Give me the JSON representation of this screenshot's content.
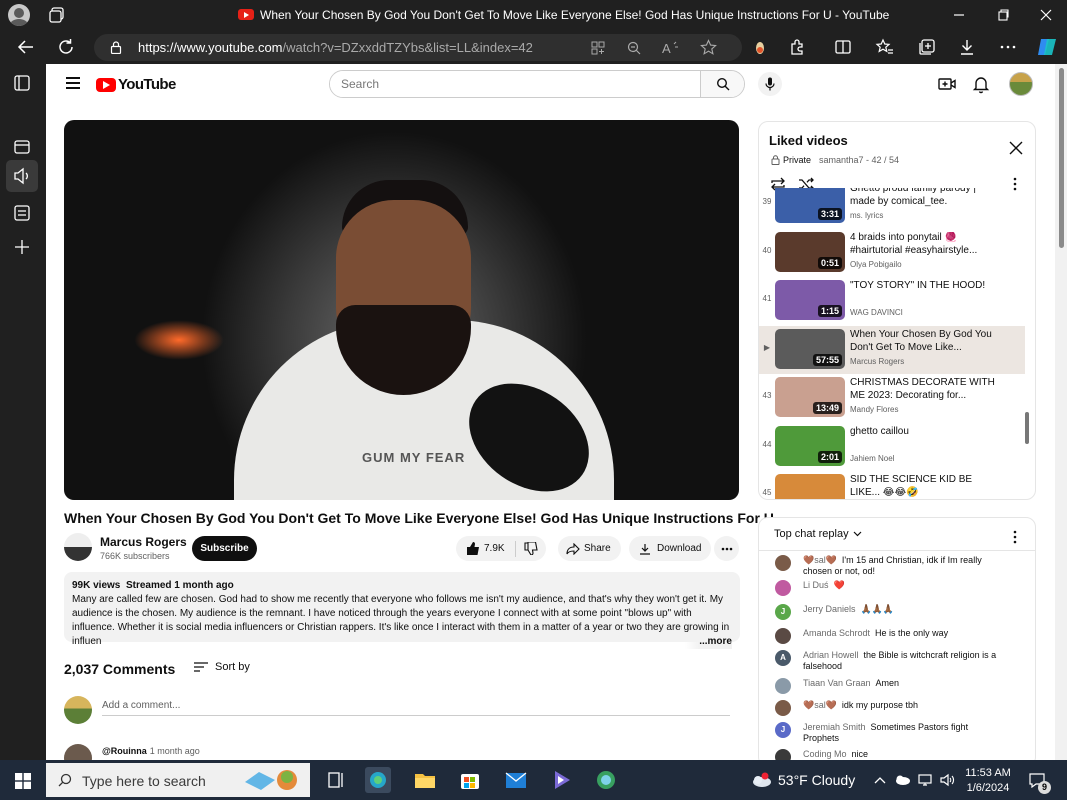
{
  "window": {
    "title": "When Your Chosen By God You Don't Get To Move Like Everyone Else! God Has Unique Instructions For U - YouTube"
  },
  "address": {
    "url_domain": "https://www.youtube.com",
    "url_path": "/watch?v=DZxxddTZYbs&list=LL&index=42"
  },
  "youtube_header": {
    "logo_text": "YouTube",
    "search_placeholder": "Search"
  },
  "video": {
    "shirt_text": "GUM MY FEAR",
    "title": "When Your Chosen By God You Don't Get To Move Like Everyone Else! God Has Unique Instructions For U",
    "channel": "Marcus Rogers",
    "subscribers": "766K subscribers",
    "subscribe_label": "Subscribe",
    "likes": "7.9K",
    "share_label": "Share",
    "download_label": "Download"
  },
  "description": {
    "views": "99K views",
    "streamed": "Streamed 1 month ago",
    "text": "Many are called few are chosen. God had to show me recently that everyone who follows me isn't my audience, and that's why they won't get it. My audience is the chosen. My audience is the remnant. I have noticed through the years everyone I connect with at some point \"blows up\" with influence. Whether it is social media influencers or Christian rappers. It's like once I interact with them in a matter of a year or two they are growing in influen",
    "more_label": "...more"
  },
  "comments": {
    "count": "2,037 Comments",
    "sort_label": "Sort by",
    "add_placeholder": "Add a comment...",
    "first_user": "@Rouinna",
    "first_time": "1 month ago"
  },
  "playlist": {
    "title": "Liked videos",
    "private_label": "Private",
    "owner_progress": "samantha7 - 42 / 54",
    "items": [
      {
        "index": "39",
        "title": "Ghetto proud family parody | made by comical_tee.",
        "channel": "ms. lyrics",
        "duration": "3:31",
        "thumb": "#3b5fa8"
      },
      {
        "index": "40",
        "title": "4 braids into ponytail 🧶 #hairtutorial #easyhairstyle...",
        "channel": "Olya Pobigailo",
        "duration": "0:51",
        "thumb": "#5a3a2c"
      },
      {
        "index": "41",
        "title": "\"TOY STORY\" IN THE HOOD!",
        "channel": "WAG DAVINCI",
        "duration": "1:15",
        "thumb": "#7d5aa8"
      },
      {
        "index": "▶",
        "title": "When Your Chosen By God You Don't Get To Move Like...",
        "channel": "Marcus Rogers",
        "duration": "57:55",
        "thumb": "#5b5b5b"
      },
      {
        "index": "43",
        "title": "CHRISTMAS DECORATE WITH ME 2023: Decorating for...",
        "channel": "Mandy Flores",
        "duration": "13:49",
        "thumb": "#c9a090"
      },
      {
        "index": "44",
        "title": "ghetto caillou",
        "channel": "Jahiem Noel",
        "duration": "2:01",
        "thumb": "#4f9a3a"
      },
      {
        "index": "45",
        "title": "SID THE SCIENCE KID BE LIKE... 😂😂🤣",
        "channel": "",
        "duration": "",
        "thumb": "#d78a3a"
      }
    ]
  },
  "chat": {
    "header": "Top chat replay",
    "messages": [
      {
        "author": "🤎sal🤎",
        "text": "I'm 15 and Christian, idk if Im really chosen or not, od!",
        "avatar_color": "#7a5b48",
        "initial": ""
      },
      {
        "author": "Li Duś",
        "text": "❤️",
        "avatar_color": "#c05aa0",
        "initial": ""
      },
      {
        "author": "Jerry Daniels",
        "text": "🙏🏾🙏🏾🙏🏾",
        "avatar_color": "#5aa74a",
        "initial": "J"
      },
      {
        "author": "Amanda Schrodt",
        "text": "He is the only way",
        "avatar_color": "#5a4a44",
        "initial": ""
      },
      {
        "author": "Adrian Howell",
        "text": "the Bible is witchcraft religion is a falsehood",
        "avatar_color": "#4a5a6a",
        "initial": "A"
      },
      {
        "author": "Tiaan Van Graan",
        "text": "Amen",
        "avatar_color": "#8a9aa8",
        "initial": ""
      },
      {
        "author": "🤎sal🤎",
        "text": "idk my purpose tbh",
        "avatar_color": "#7a5b48",
        "initial": ""
      },
      {
        "author": "Jeremiah Smith",
        "text": "Sometimes Pastors fight Prophets",
        "avatar_color": "#5a6ac8",
        "initial": "J"
      },
      {
        "author": "Coding Mo",
        "text": "nice",
        "avatar_color": "#3a3a3a",
        "initial": ""
      }
    ]
  },
  "taskbar": {
    "search_placeholder": "Type here to search",
    "weather": "53°F  Cloudy",
    "time": "11:53 AM",
    "date": "1/6/2024",
    "notification_count": "9"
  }
}
